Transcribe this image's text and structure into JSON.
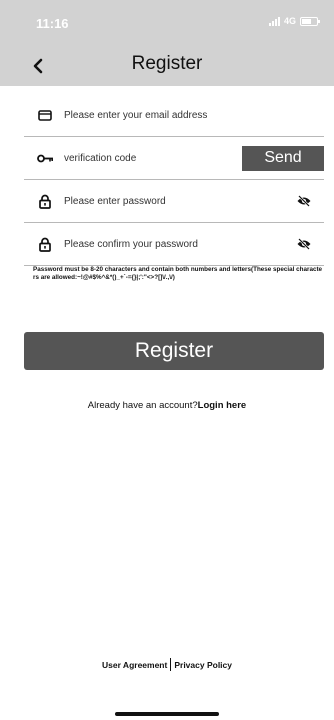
{
  "status_bar": {
    "time": "11:16",
    "network": "4G",
    "icons": [
      "signal-icon",
      "battery-icon"
    ]
  },
  "nav": {
    "title": "Register",
    "back_icon": "chevron-left-icon"
  },
  "form": {
    "email": {
      "placeholder": "Please enter your email address",
      "value": "",
      "icon": "envelope-icon"
    },
    "verification": {
      "placeholder": "verification code",
      "value": "",
      "icon": "key-icon",
      "send_label": "Send"
    },
    "password": {
      "placeholder": "Please enter password",
      "value": "",
      "icon": "lock-icon",
      "toggle_icon": "eye-off-icon"
    },
    "confirm_password": {
      "placeholder": "Please confirm your password",
      "value": "",
      "icon": "lock-icon",
      "toggle_icon": "eye-off-icon"
    },
    "password_hint": "Password must be 8-20 characters and contain both numbers and letters(These special characters are allowed:~!@#$%^&*()_+`-={}|;':\"<>?[]\\/.,\\/)"
  },
  "register_button": {
    "label": "Register"
  },
  "login_prompt": {
    "text": "Already have an account?",
    "link": "Login here"
  },
  "footer": {
    "user_agreement": "User Agreement",
    "privacy_policy": "Privacy Policy"
  },
  "colors": {
    "header_background": "#d2d2d2",
    "button_background": "#555555",
    "page_background": "#ffffff"
  }
}
